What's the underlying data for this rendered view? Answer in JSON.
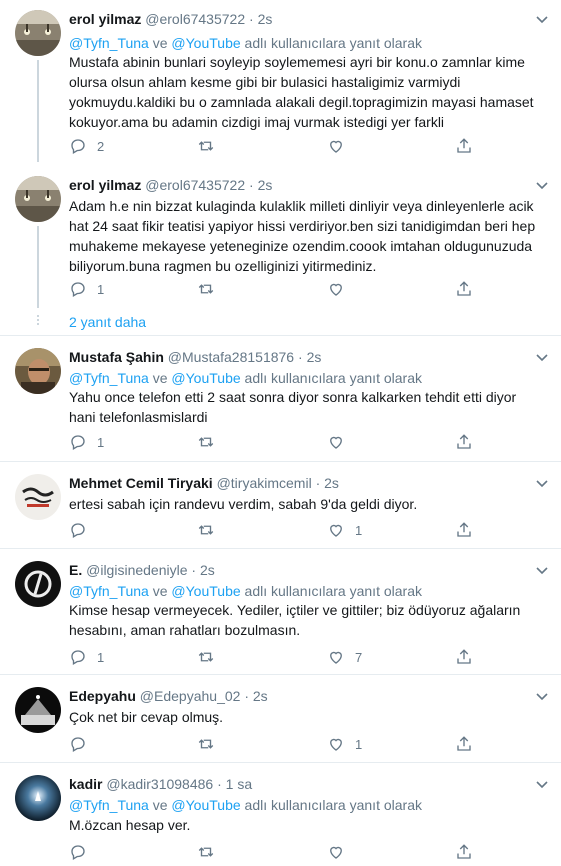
{
  "reply_to_suffix": "adlı kullanıcılara yanıt olarak",
  "reply_to_mention_a": "@Tyfn_Tuna",
  "reply_to_and": "ve",
  "reply_to_mention_b": "@YouTube",
  "dot": "·",
  "more_replies": "2 yanıt daha",
  "tweets": [
    {
      "name": "erol yilmaz",
      "handle": "@erol67435722",
      "time": "2s",
      "lines": [
        "Mustafa abinin bunlari soyleyip soylememesi ayri bir konu.o zamnlar kime",
        "olursa olsun ahlam kesme gibi bir bulasici hastaligimiz varmiydi",
        "yokmuydu.kaldiki bu o zamnlada alakali degil.topragimizin mayasi hamaset",
        "kokuyor.ama bu adamin cizdigi imaj vurmak istedigi yer farkli"
      ],
      "reply_count": "2",
      "retweet_count": "",
      "like_count": ""
    },
    {
      "name": "erol yilmaz",
      "handle": "@erol67435722",
      "time": "2s",
      "lines": [
        "Adam h.e nin bizzat kulaginda kulaklik milleti dinliyir veya dinleyenlerle acik",
        "hat 24 saat fikir teatisi yapiyor hissi verdiriyor.ben sizi tanidigimdan beri hep",
        "muhakeme mekayese yeteneginize ozendim.coook imtahan oldugunuzuda",
        "biliyorum.buna ragmen bu ozelliginizi yitirmediniz."
      ],
      "reply_count": "1",
      "retweet_count": "",
      "like_count": ""
    },
    {
      "name": "Mustafa Şahin",
      "handle": "@Mustafa28151876",
      "time": "2s",
      "lines": [
        "Yahu once telefon etti 2 saat sonra diyor sonra kalkarken tehdit etti diyor",
        "hani telefonlasmislardi"
      ],
      "reply_count": "1",
      "retweet_count": "",
      "like_count": ""
    },
    {
      "name": "Mehmet Cemil Tiryaki",
      "handle": "@tiryakimcemil",
      "time": "2s",
      "lines": [
        "ertesi sabah için randevu verdim, sabah 9'da geldi diyor."
      ],
      "reply_count": "",
      "retweet_count": "",
      "like_count": "1"
    },
    {
      "name": "E.",
      "handle": "@ilgisinedeniyle",
      "time": "2s",
      "lines": [
        "Kimse hesap vermeyecek. Yediler, içtiler ve gittiler; biz ödüyoruz ağaların",
        "hesabını, aman rahatları bozulmasın."
      ],
      "reply_count": "1",
      "retweet_count": "",
      "like_count": "7"
    },
    {
      "name": "Edepyahu",
      "handle": "@Edepyahu_02",
      "time": "2s",
      "lines": [
        "Çok net bir  cevap olmuş."
      ],
      "reply_count": "",
      "retweet_count": "",
      "like_count": "1"
    },
    {
      "name": "kadir",
      "handle": "@kadir31098486",
      "time": "1 sa",
      "lines": [
        "M.özcan hesap ver."
      ],
      "reply_count": "",
      "retweet_count": "",
      "like_count": ""
    }
  ],
  "icons": {
    "reply": "reply-icon",
    "retweet": "retweet-icon",
    "like": "like-icon",
    "share": "share-icon",
    "caret": "chevron-down-icon"
  },
  "colors": {
    "link": "#1da1f2",
    "secondary": "#657786",
    "divider": "#e6ecf0",
    "thread": "#ccd6dd"
  }
}
